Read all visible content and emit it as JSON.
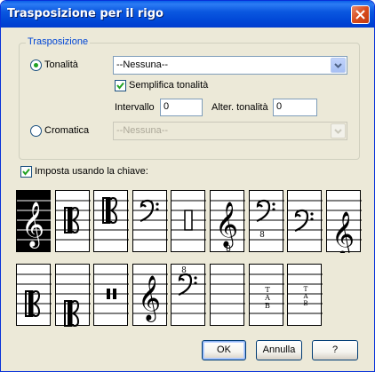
{
  "window": {
    "title": "Trasposizione per il rigo"
  },
  "group": {
    "legend": "Trasposizione",
    "tonalita": {
      "label": "Tonalità",
      "selected": true,
      "value": "--Nessuna--"
    },
    "semplifica": {
      "label": "Semplifica tonalità",
      "checked": true
    },
    "intervallo": {
      "label": "Intervallo",
      "value": "0"
    },
    "alter": {
      "label": "Alter. tonalità",
      "value": "0"
    },
    "cromatica": {
      "label": "Cromatica",
      "selected": false,
      "value": "--Nessuna--"
    }
  },
  "imposta": {
    "label": "Imposta usando la chiave:",
    "checked": true
  },
  "clefs": [
    {
      "name": "treble-clef",
      "selected": true
    },
    {
      "name": "alto-clef",
      "selected": false
    },
    {
      "name": "tenor-clef",
      "selected": false
    },
    {
      "name": "bass-clef",
      "selected": false
    },
    {
      "name": "percussion-clef",
      "selected": false
    },
    {
      "name": "treble-8vb-clef",
      "selected": false
    },
    {
      "name": "bass-8vb-clef",
      "selected": false
    },
    {
      "name": "baritone-clef",
      "selected": false
    },
    {
      "name": "french-violin-clef",
      "selected": false
    },
    {
      "name": "mezzo-soprano-clef",
      "selected": false
    },
    {
      "name": "baritone-c-clef",
      "selected": false
    },
    {
      "name": "percussion-clef-2",
      "selected": false
    },
    {
      "name": "treble-8va-clef",
      "selected": false
    },
    {
      "name": "bass-8va-clef",
      "selected": false
    },
    {
      "name": "no-clef",
      "selected": false
    },
    {
      "name": "tab-clef",
      "selected": false
    },
    {
      "name": "tab-clef-small",
      "selected": false
    }
  ],
  "buttons": {
    "ok": "OK",
    "cancel": "Annulla",
    "help": "?"
  },
  "colors": {
    "titlebar": "#0054e3",
    "face": "#ece9d8",
    "legend": "#0046d5"
  }
}
